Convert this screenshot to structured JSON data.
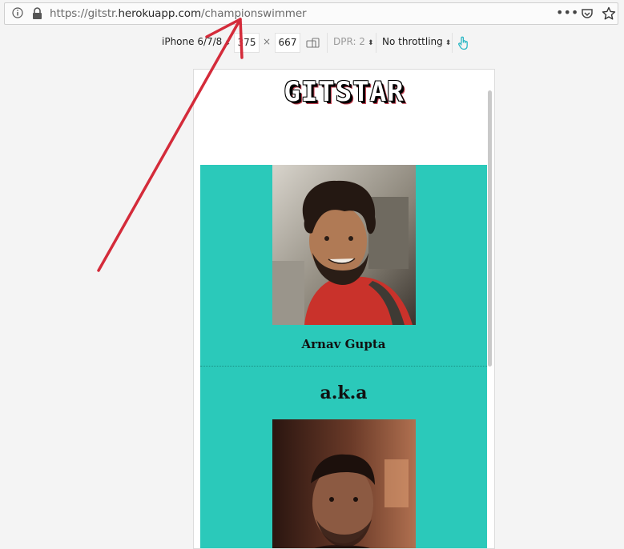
{
  "browser": {
    "url_prefix": "https://gitstr.",
    "url_host": "herokuapp.com",
    "url_path": "/championswimmer",
    "menu_dots": "•••"
  },
  "responsive_toolbar": {
    "device": "iPhone 6/7/8",
    "width": "375",
    "times": "×",
    "height": "667",
    "dpr": "DPR: 2",
    "throttling": "No throttling"
  },
  "page": {
    "logo": "GITSTAR",
    "user_name": "Arnav Gupta",
    "aka": "a.k.a"
  },
  "colors": {
    "teal": "#2bc9ba",
    "arrow": "#d42b3a"
  }
}
